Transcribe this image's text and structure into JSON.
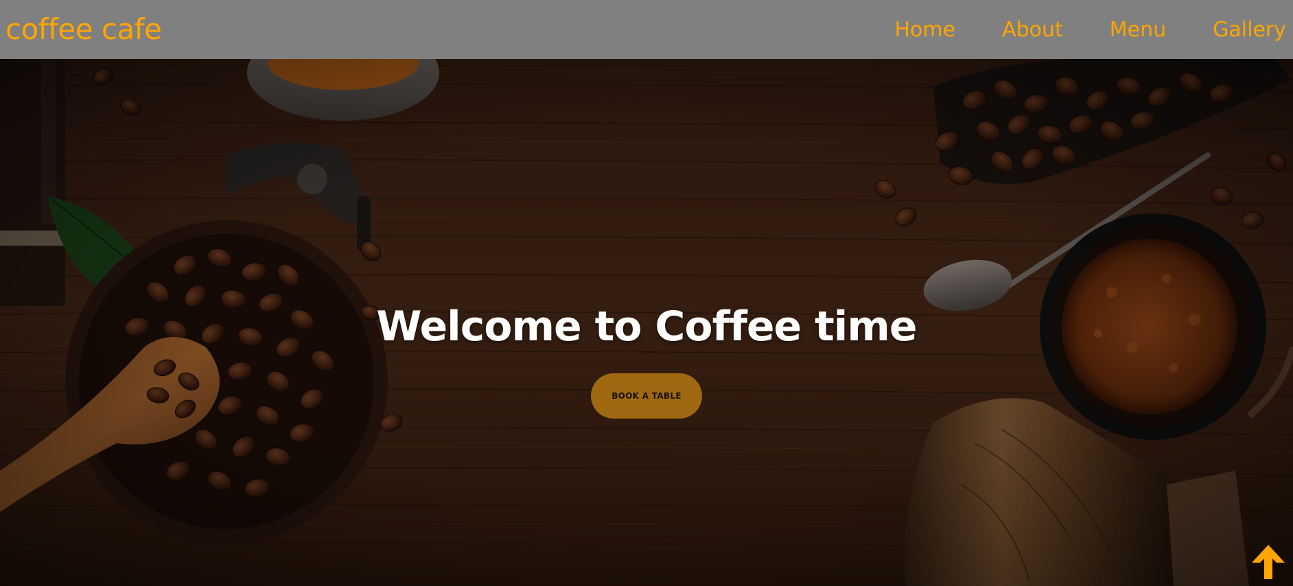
{
  "header": {
    "brand": "coffee cafe",
    "nav": [
      {
        "label": "Home"
      },
      {
        "label": "About"
      },
      {
        "label": "Menu"
      },
      {
        "label": "Gallery"
      }
    ]
  },
  "hero": {
    "title": "Welcome to Coffee time",
    "button_label": "BOOK A TABLE",
    "background_image": "coffee-beans-on-wooden-table"
  },
  "scroll_top": {
    "icon": "arrow-up-icon"
  },
  "colors": {
    "accent": "#ffa500",
    "navbar_bg": "#808080",
    "title": "#ffffff",
    "button_bg": "#ca8814"
  }
}
